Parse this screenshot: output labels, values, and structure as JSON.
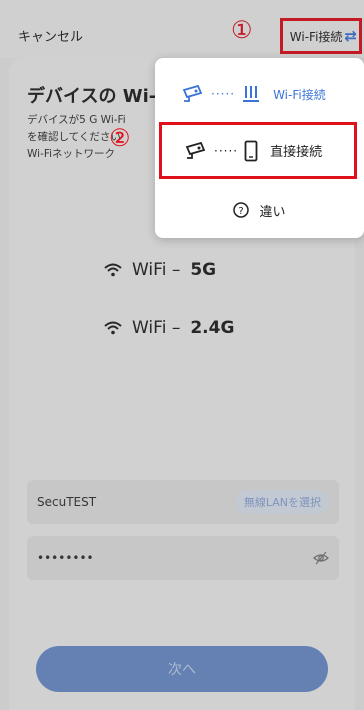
{
  "header": {
    "cancel_label": "キャンセル",
    "mode_label": "Wi-Fi接続",
    "mode_icon": "swap-arrows-icon",
    "marker_1": "①",
    "marker_2": "②"
  },
  "main": {
    "title": "デバイスの Wi-Fi",
    "desc_lines": [
      "デバイスが5 G Wi-Fi",
      "を確認してください",
      "Wi-Fiネットワーク"
    ],
    "bands": [
      {
        "prefix": "WiFi –",
        "band": "5G"
      },
      {
        "prefix": "WiFi –",
        "band": "2.4G"
      }
    ],
    "ssid_value": "SecuTEST",
    "select_lan_label": "無線LANを選択",
    "password_value": "••••••••",
    "next_label": "次へ"
  },
  "menu": {
    "items": [
      {
        "label": "Wi-Fi接続",
        "icons": [
          "camera-icon",
          "router-icon"
        ],
        "dots": "·····"
      },
      {
        "label": "直接接続",
        "icons": [
          "camera-icon",
          "phone-icon"
        ],
        "dots": "·····"
      },
      {
        "label": "違い",
        "icons": [
          "help-circle-icon"
        ]
      }
    ]
  },
  "colors": {
    "accent": "#3b74d8",
    "highlight": "#e0101c",
    "button": "#6c8ecb"
  }
}
